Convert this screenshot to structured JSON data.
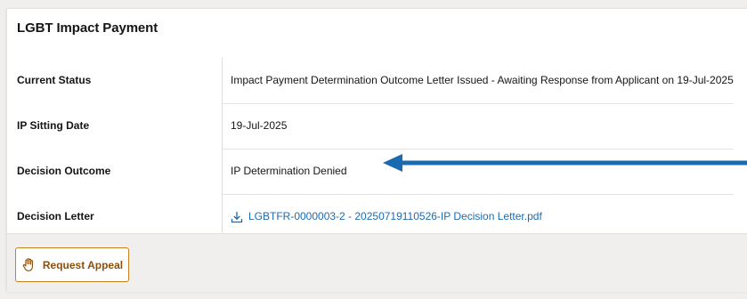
{
  "panel": {
    "title": "LGBT Impact Payment"
  },
  "rows": [
    {
      "label": "Current Status",
      "value": "Impact Payment Determination Outcome Letter Issued - Awaiting Response from Applicant on 19-Jul-2025"
    },
    {
      "label": "IP Sitting Date",
      "value": "19-Jul-2025"
    },
    {
      "label": "Decision Outcome",
      "value": "IP Determination Denied"
    },
    {
      "label": "Decision Letter",
      "value": "LGBTFR-0000003-2 - 20250719110526-IP Decision Letter.pdf"
    }
  ],
  "footer": {
    "appeal_label": "Request Appeal"
  },
  "icons": {
    "download": "download-icon",
    "appeal": "hand-icon",
    "annotation": "arrow-left-icon"
  },
  "colors": {
    "link": "#1c6bb3",
    "appeal_border": "#c9801f",
    "appeal_text": "#8c4f0d",
    "annotation_arrow": "#1a6ab0"
  }
}
